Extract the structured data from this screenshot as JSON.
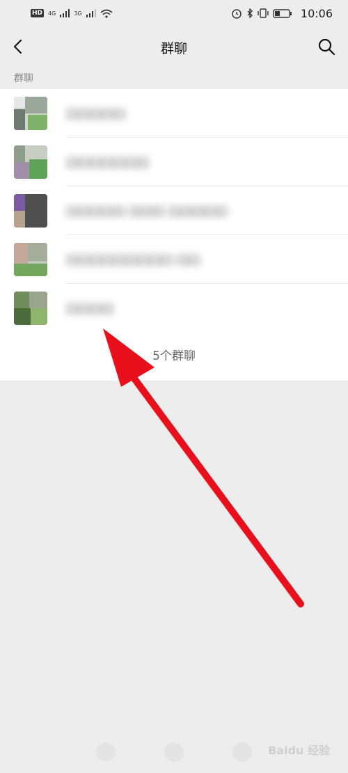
{
  "status_bar": {
    "left_badges": [
      "HD",
      "4G",
      "3G"
    ],
    "time": "10:06"
  },
  "nav": {
    "title": "群聊",
    "back_icon": "chevron-left-icon",
    "search_icon": "search-icon"
  },
  "section": {
    "header": "群聊"
  },
  "groups": [
    {
      "name": "口口口口口"
    },
    {
      "name": "口口口口口口口"
    },
    {
      "name": "口口口口口 口口口 口口口口口"
    },
    {
      "name": "口口口口口口口口口 口口"
    },
    {
      "name": "口口口口"
    }
  ],
  "footer": {
    "count_label": "5个群聊"
  },
  "watermark": "Baidu 经验",
  "colors": {
    "arrow": "#e8101a",
    "background": "#ededed",
    "list_bg": "#ffffff"
  }
}
